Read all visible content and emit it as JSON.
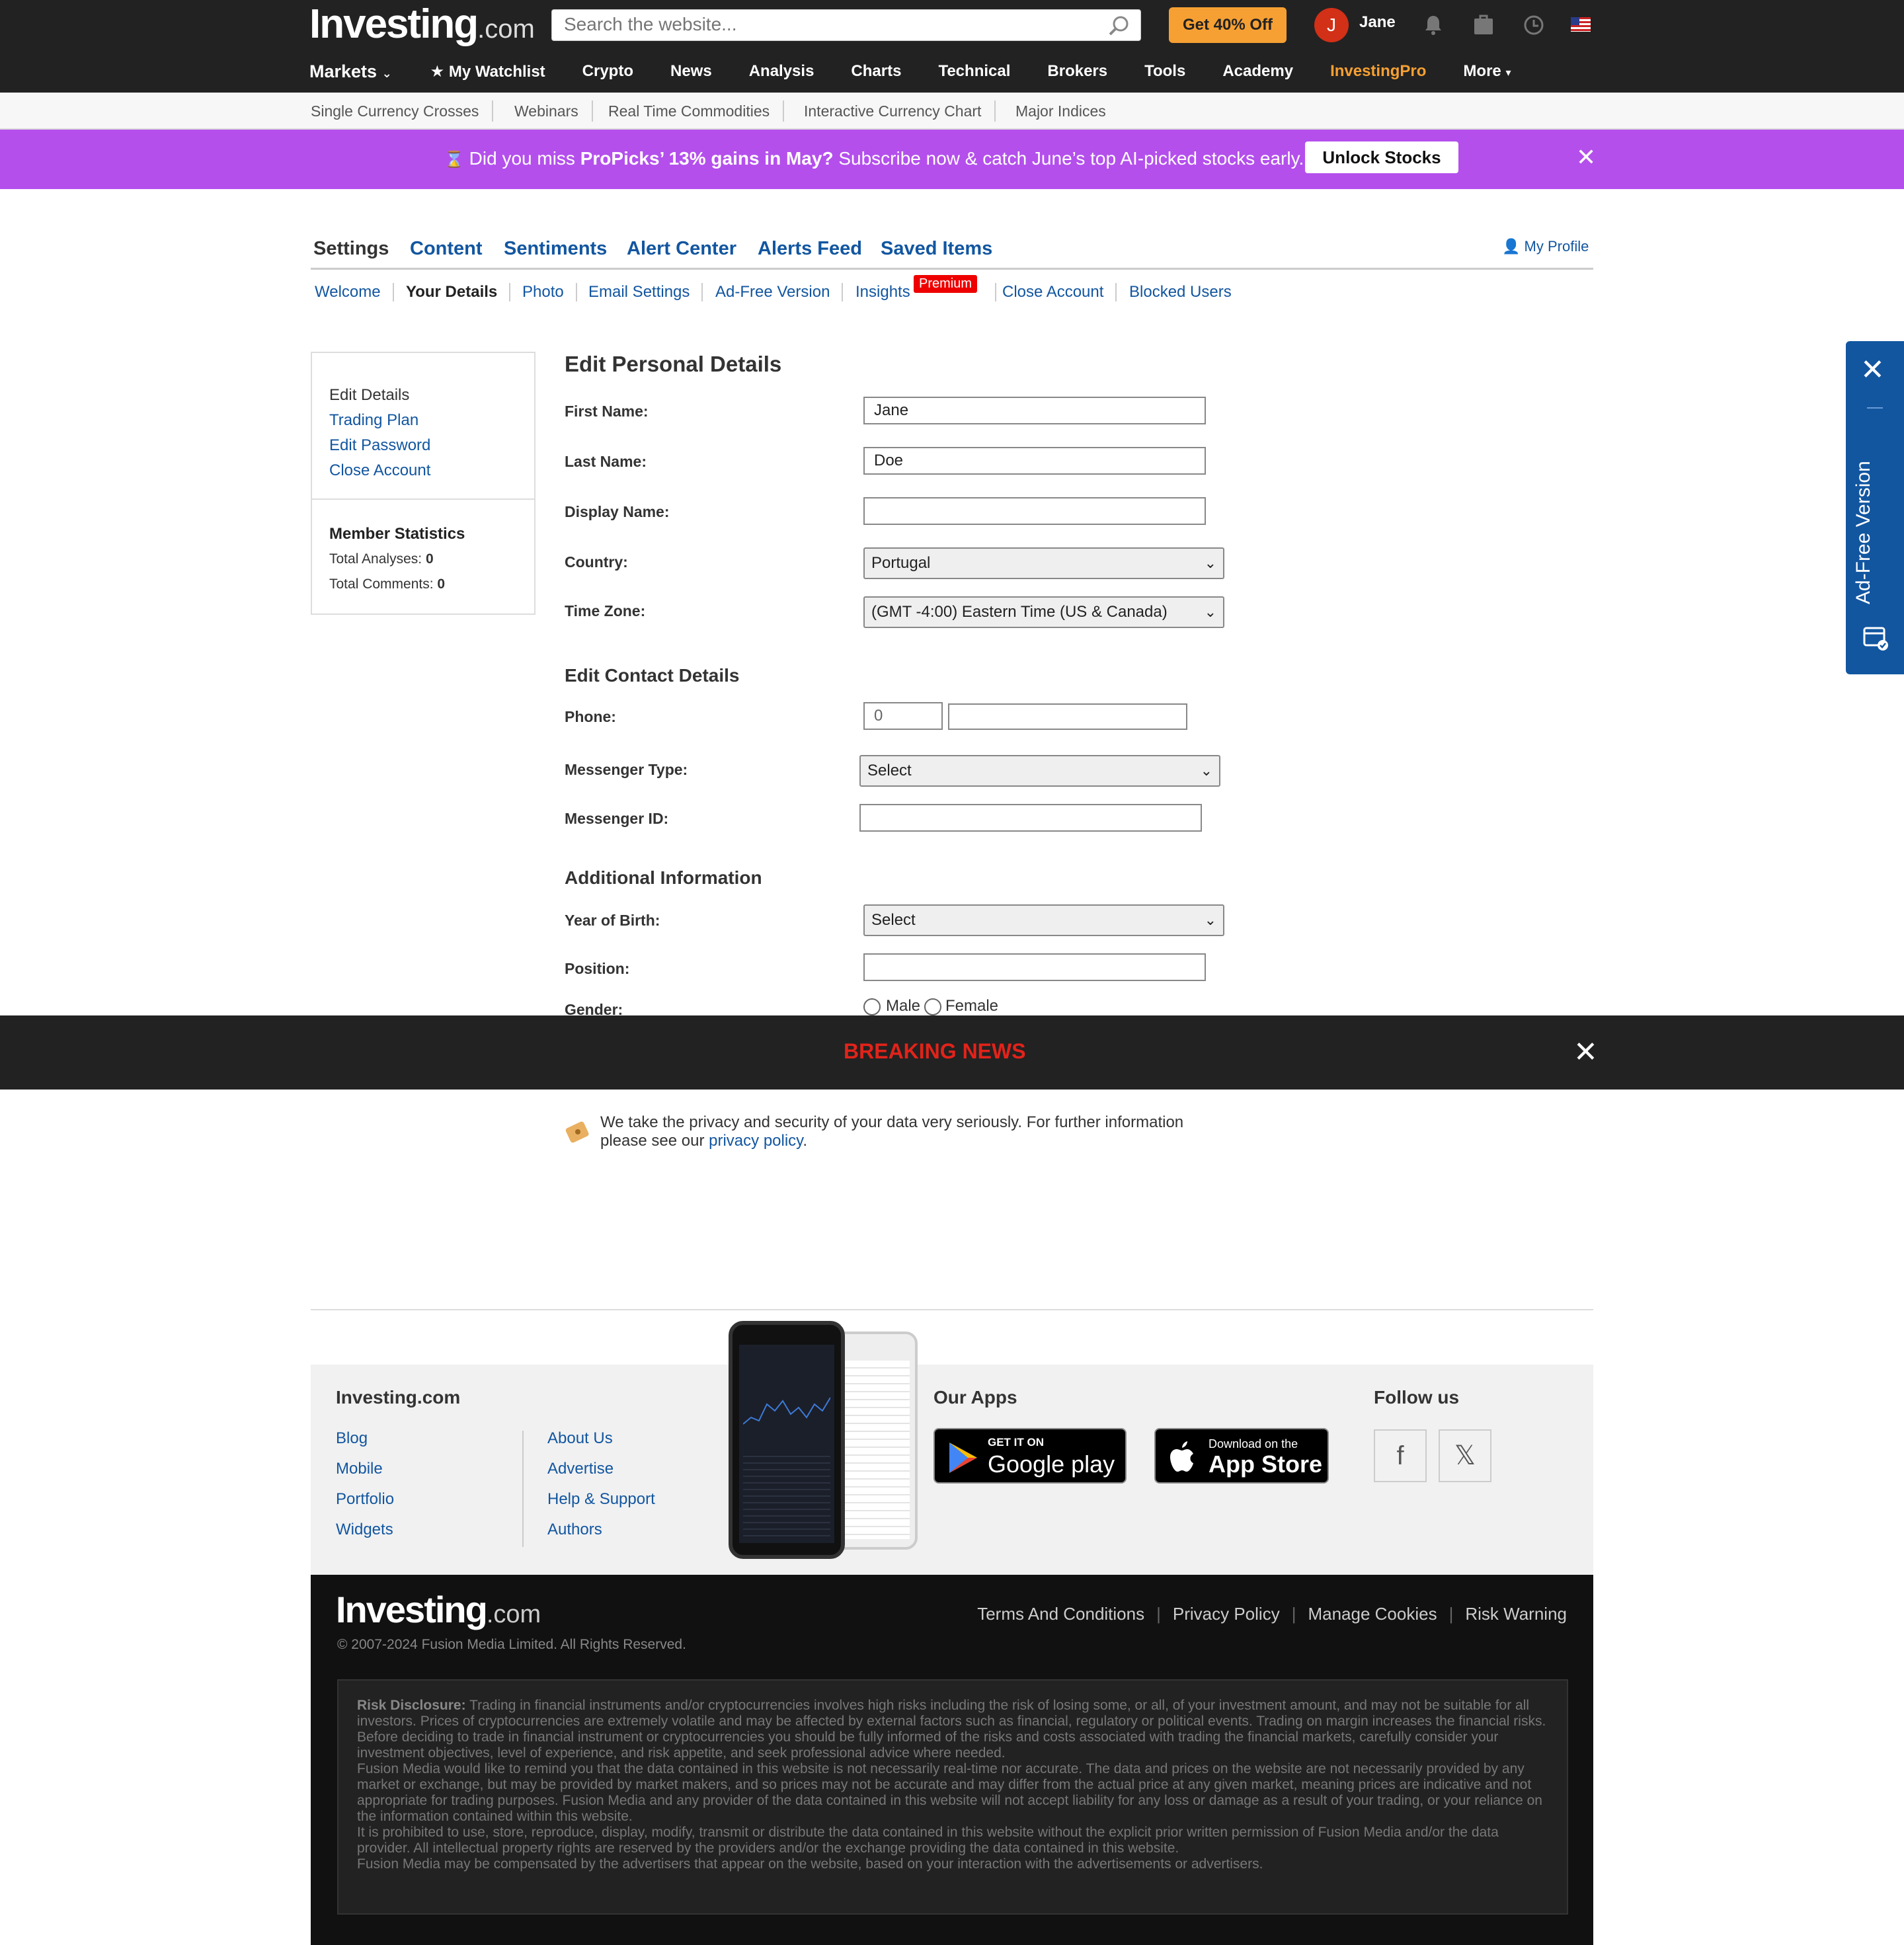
{
  "header": {
    "logo": "Investing",
    "logo_suffix": ".com",
    "search_placeholder": "Search the website...",
    "offer_button": "Get 40% Off",
    "avatar_initial": "J",
    "user_name": "Jane",
    "icons": [
      "bell-icon",
      "portfolio-icon",
      "clock-icon",
      "us-flag-icon"
    ],
    "nav": [
      "Markets",
      "My Watchlist",
      "Crypto",
      "News",
      "Analysis",
      "Charts",
      "Technical",
      "Brokers",
      "Tools",
      "Academy",
      "InvestingPro",
      "More"
    ],
    "subnav": [
      "Single Currency Crosses",
      "Webinars",
      "Real Time Commodities",
      "Interactive Currency Chart",
      "Major Indices"
    ]
  },
  "promo": {
    "prefix": "Did you miss",
    "bold": "ProPicks’ 13% gains in May?",
    "suffix": "Subscribe now & catch June’s top AI-picked stocks early.",
    "button": "Unlock Stocks",
    "bg_color": "#b44fec"
  },
  "settings": {
    "tabs": [
      "Settings",
      "Content",
      "Sentiments",
      "Alert Center",
      "Alerts Feed",
      "Saved Items"
    ],
    "my_profile": "My Profile",
    "subtabs": [
      "Welcome",
      "Your Details",
      "Photo",
      "Email Settings",
      "Ad-Free Version",
      "Insights",
      "Close Account",
      "Blocked Users"
    ],
    "premium_badge": "Premium"
  },
  "left_panel": {
    "active": "Edit Details",
    "links": [
      "Trading Plan",
      "Edit Password",
      "Close Account"
    ],
    "stats_title": "Member Statistics",
    "analyses_label": "Total Analyses:",
    "analyses_value": "0",
    "comments_label": "Total Comments:",
    "comments_value": "0"
  },
  "form": {
    "personal_title": "Edit Personal Details",
    "first_name_label": "First Name:",
    "first_name": "Jane",
    "last_name_label": "Last Name:",
    "last_name": "Doe",
    "display_name_label": "Display Name:",
    "display_name": "",
    "country_label": "Country:",
    "country": "Portugal",
    "timezone_label": "Time Zone:",
    "timezone": "(GMT -4:00) Eastern Time (US & Canada)",
    "contact_title": "Edit Contact Details",
    "phone_label": "Phone:",
    "phone_code": "0",
    "phone_number": "",
    "messenger_type_label": "Messenger Type:",
    "messenger_type": "Select",
    "messenger_id_label": "Messenger ID:",
    "messenger_id": "",
    "additional_title": "Additional Information",
    "year_label": "Year of Birth:",
    "year": "Select",
    "position_label": "Position:",
    "position": "",
    "gender_label": "Gender:",
    "male": "Male",
    "female": "Female"
  },
  "breaking": {
    "title": "BREAKING NEWS",
    "color": "#e2231a"
  },
  "privacy": {
    "text": "We take the privacy and security of your data very seriously. For further information please see our",
    "link": "privacy policy",
    "end": "."
  },
  "footer": {
    "col1_title": "Investing.com",
    "col1_links": [
      "Blog",
      "Mobile",
      "Portfolio",
      "Widgets"
    ],
    "col2_links": [
      "About Us",
      "Advertise",
      "Help & Support",
      "Authors"
    ],
    "apps_title": "Our Apps",
    "google_small": "GET IT ON",
    "google_big": "Google play",
    "apple_small": "Download on the",
    "apple_big": "App Store",
    "follow_title": "Follow us",
    "social": [
      "facebook-icon",
      "x-icon"
    ],
    "logo": "Investing",
    "logo_suffix": ".com",
    "copyright": "© 2007-2024 Fusion Media Limited. All Rights Reserved.",
    "legal_links": [
      "Terms And Conditions",
      "Privacy Policy",
      "Manage Cookies",
      "Risk Warning"
    ],
    "risk_label": "Risk Disclosure:",
    "risk_p1": "Trading in financial instruments and/or cryptocurrencies involves high risks including the risk of losing some, or all, of your investment amount, and may not be suitable for all investors. Prices of cryptocurrencies are extremely volatile and may be affected by external factors such as financial, regulatory or political events. Trading on margin increases the financial risks.",
    "risk_p2": "Before deciding to trade in financial instrument or cryptocurrencies you should be fully informed of the risks and costs associated with trading the financial markets, carefully consider your investment objectives, level of experience, and risk appetite, and seek professional advice where needed.",
    "risk_p3": "Fusion Media would like to remind you that the data contained in this website is not necessarily real-time nor accurate. The data and prices on the website are not necessarily provided by any market or exchange, but may be provided by market makers, and so prices may not be accurate and may differ from the actual price at any given market, meaning prices are indicative and not appropriate for trading purposes. Fusion Media and any provider of the data contained in this website will not accept liability for any loss or damage as a result of your trading, or your reliance on the information contained within this website.",
    "risk_p4": "It is prohibited to use, store, reproduce, display, modify, transmit or distribute the data contained in this website without the explicit prior written permission of Fusion Media and/or the data provider. All intellectual property rights are reserved by the providers and/or the exchange providing the data contained in this website.",
    "risk_p5": "Fusion Media may be compensated by the advertisers that appear on the website, based on your interaction with the advertisements or advertisers."
  },
  "side_tab": {
    "label": "Ad-Free Version"
  }
}
